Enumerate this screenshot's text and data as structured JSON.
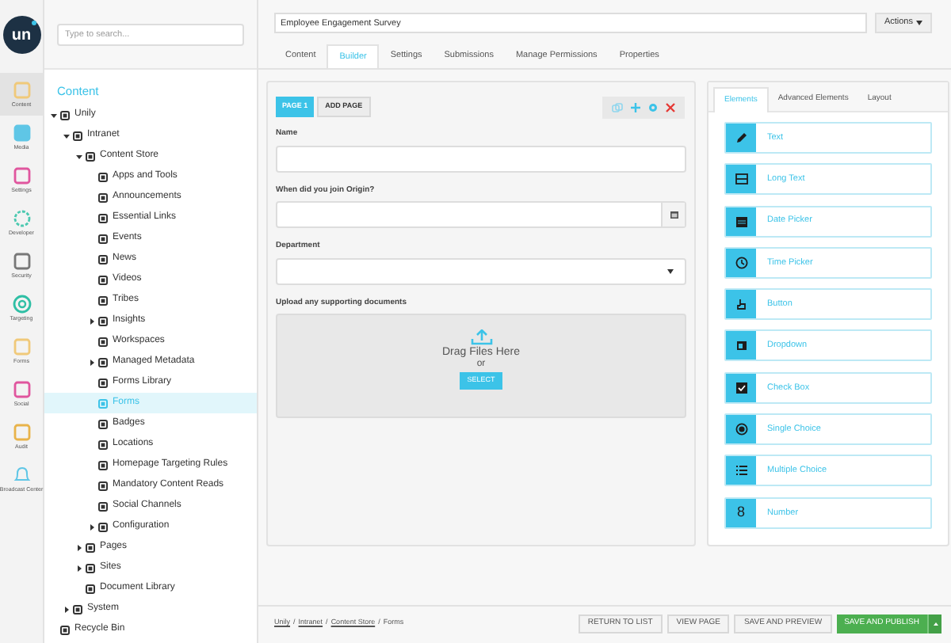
{
  "logo": "un",
  "rail": [
    {
      "label": "Content",
      "selected": true
    },
    {
      "label": "Media",
      "selected": false
    },
    {
      "label": "Settings",
      "selected": false
    },
    {
      "label": "Developer",
      "selected": false
    },
    {
      "label": "Security",
      "selected": false
    },
    {
      "label": "Targeting",
      "selected": false
    },
    {
      "label": "Forms",
      "selected": false
    },
    {
      "label": "Social",
      "selected": false
    },
    {
      "label": "Audit",
      "selected": false
    },
    {
      "label": "Broadcast Center",
      "selected": false
    }
  ],
  "search": {
    "placeholder": "Type to search..."
  },
  "tree_title": "Content",
  "tree": [
    {
      "label": "Unily",
      "expanded": true,
      "selected": false,
      "children": [
        {
          "label": "Intranet",
          "expanded": true,
          "selected": false,
          "children": [
            {
              "label": "Content Store",
              "expanded": true,
              "selected": false,
              "children": [
                {
                  "label": "Apps and Tools",
                  "selected": false
                },
                {
                  "label": "Announcements",
                  "selected": false
                },
                {
                  "label": "Essential Links",
                  "selected": false
                },
                {
                  "label": "Events",
                  "selected": false
                },
                {
                  "label": "News",
                  "selected": false
                },
                {
                  "label": "Videos",
                  "selected": false
                },
                {
                  "label": "Tribes",
                  "selected": false
                },
                {
                  "label": "Insights",
                  "expanded": false,
                  "selected": false
                },
                {
                  "label": "Workspaces",
                  "selected": false
                },
                {
                  "label": "Managed Metadata",
                  "expanded": false,
                  "selected": false
                },
                {
                  "label": "Forms Library",
                  "selected": false
                },
                {
                  "label": "Forms",
                  "selected": true
                },
                {
                  "label": "Badges",
                  "selected": false
                },
                {
                  "label": "Locations",
                  "selected": false
                },
                {
                  "label": "Homepage Targeting Rules",
                  "selected": false
                },
                {
                  "label": "Mandatory Content Reads",
                  "selected": false
                },
                {
                  "label": "Social Channels",
                  "selected": false
                },
                {
                  "label": "Configuration",
                  "expanded": false,
                  "selected": false
                }
              ]
            },
            {
              "label": "Pages",
              "expanded": false,
              "selected": false
            },
            {
              "label": "Sites",
              "expanded": false,
              "selected": false
            },
            {
              "label": "Document Library",
              "selected": false
            }
          ]
        },
        {
          "label": "System",
          "expanded": false,
          "selected": false
        }
      ]
    },
    {
      "label": "Recycle Bin",
      "selected": false
    }
  ],
  "form_title": "Employee Engagement Survey",
  "actions_button": "Actions",
  "tabs": [
    {
      "label": "Content",
      "selected": false
    },
    {
      "label": "Builder",
      "selected": true
    },
    {
      "label": "Settings",
      "selected": false
    },
    {
      "label": "Submissions",
      "selected": false
    },
    {
      "label": "Manage Permissions",
      "selected": false
    },
    {
      "label": "Properties",
      "selected": false
    }
  ],
  "pages": [
    {
      "label": "PAGE 1",
      "selected": true
    },
    {
      "label": "ADD PAGE",
      "selected": false
    }
  ],
  "fields": [
    {
      "kind": "text",
      "label": "Name"
    },
    {
      "kind": "date",
      "label": "When did you join Origin?"
    },
    {
      "kind": "select",
      "label": "Department"
    },
    {
      "kind": "upload",
      "label": "Upload any supporting documents",
      "drop_text": "Drag Files Here",
      "or_text": "or",
      "button": "SELECT"
    }
  ],
  "palette_tabs": [
    {
      "label": "Elements",
      "selected": true
    },
    {
      "label": "Advanced Elements",
      "selected": false
    },
    {
      "label": "Layout",
      "selected": false
    }
  ],
  "elements": [
    {
      "label": "Text"
    },
    {
      "label": "Long Text"
    },
    {
      "label": "Date Picker"
    },
    {
      "label": "Time Picker"
    },
    {
      "label": "Button"
    },
    {
      "label": "Dropdown"
    },
    {
      "label": "Check Box"
    },
    {
      "label": "Single Choice"
    },
    {
      "label": "Multiple Choice"
    },
    {
      "label": "Number",
      "glyph": "8"
    }
  ],
  "breadcrumbs": [
    {
      "label": "Unily",
      "link": true
    },
    {
      "separator": "/",
      "label": "Intranet",
      "link": true
    },
    {
      "separator": "/",
      "label": "Content Store",
      "link": true
    },
    {
      "separator": "/",
      "label": "Forms",
      "link": false
    }
  ],
  "footer_buttons": [
    {
      "label": "RETURN TO LIST",
      "kind": "plain"
    },
    {
      "label": "VIEW PAGE",
      "kind": "plain"
    },
    {
      "label": "SAVE AND PREVIEW",
      "kind": "plain"
    },
    {
      "label": "SAVE AND PUBLISH",
      "kind": "primary"
    }
  ]
}
